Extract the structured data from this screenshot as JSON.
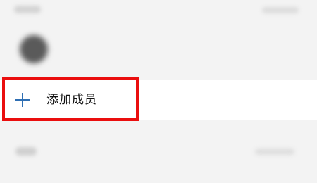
{
  "add_member": {
    "label": "添加成员",
    "icon": "plus-icon"
  },
  "colors": {
    "accent_blue": "#2f6fb3",
    "highlight_red": "#ea0e0e",
    "row_background": "#ffffff",
    "page_background": "#f3f3f3"
  }
}
